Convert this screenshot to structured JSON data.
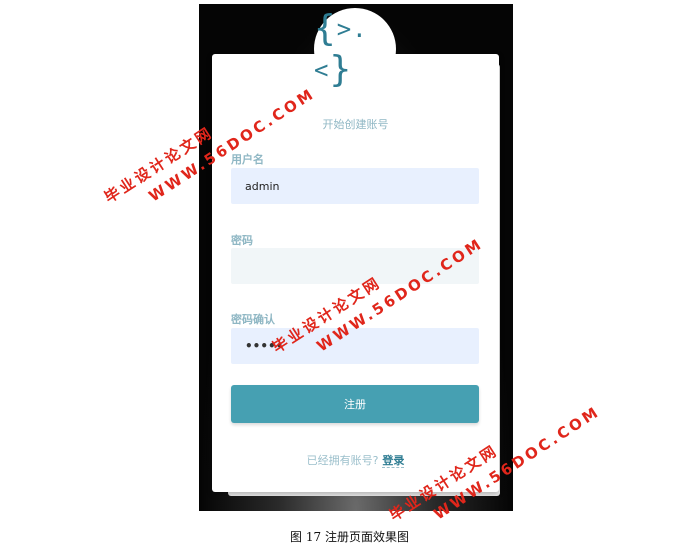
{
  "logo": {
    "glyph": ">.<"
  },
  "form": {
    "title": "开始创建账号",
    "username_label": "用户名",
    "username_value": "admin",
    "password_label": "密码",
    "password_value": "",
    "confirm_label": "密码确认",
    "confirm_value": "•••••",
    "submit_label": "注册",
    "have_account_text": "已经拥有账号?",
    "login_link": "登录"
  },
  "caption": "图 17  注册页面效果图",
  "watermark": {
    "line1": "毕业设计论文网",
    "line2": "WWW.56DOC.COM"
  },
  "colors": {
    "accent": "#46a0b2",
    "label": "#8fb7c4",
    "watermark": "#e0261b"
  }
}
